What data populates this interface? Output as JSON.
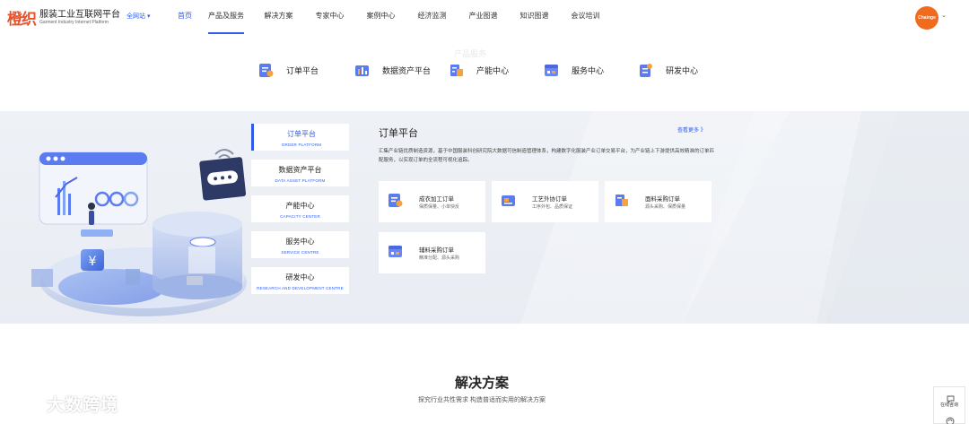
{
  "header": {
    "logo_mark": "橙织",
    "logo_cn": "服装工业互联网平台",
    "logo_en": "Garment Industry Internet Platform",
    "site_switch": "全网站 ▾",
    "nav": [
      "首页",
      "产品及服务",
      "解决方案",
      "专家中心",
      "案例中心",
      "经济监测",
      "产业图谱",
      "知识图谱",
      "会议培训"
    ],
    "active_nav": "产品及服务",
    "avatar_text": "Chainge"
  },
  "categories": [
    {
      "label": "订单平台",
      "icon": "order-icon"
    },
    {
      "label": "数据资产平台",
      "icon": "data-asset-icon"
    },
    {
      "label": "产能中心",
      "icon": "capacity-icon"
    },
    {
      "label": "服务中心",
      "icon": "service-icon"
    },
    {
      "label": "研发中心",
      "icon": "rnd-icon"
    }
  ],
  "ghost_text": "产品服务",
  "tabs": [
    {
      "cn": "订单平台",
      "en": "ORDER PLATFORM"
    },
    {
      "cn": "数据资产平台",
      "en": "DATA ASSET PLATFORM"
    },
    {
      "cn": "产能中心",
      "en": "CAPACITY CENTER"
    },
    {
      "cn": "服务中心",
      "en": "SERVICE CENTRE"
    },
    {
      "cn": "研发中心",
      "en": "RESEARCH AND DEVELOPMENT CENTRE"
    }
  ],
  "content": {
    "title": "订单平台",
    "more": "查看更多 》",
    "description": "汇集产业链优质制造资源，基于中国服装科创研究院大数据可信制造管理体系，构建数字化服装产业订单交易平台，为产业链上下游提供高效精准的订单匹配服务，以实现订单的全流程可视化追踪。",
    "cards": [
      {
        "title": "成衣加工订单",
        "sub": "保质保量、小单快反",
        "icon": "garment-order-icon"
      },
      {
        "title": "工艺外协订单",
        "sub": "工序外包、品质保证",
        "icon": "craft-order-icon"
      },
      {
        "title": "面料采购订单",
        "sub": "源头采购、保质保量",
        "icon": "fabric-order-icon"
      },
      {
        "title": "辅料采购订单",
        "sub": "精准分配、源头采购",
        "icon": "accessory-order-icon"
      }
    ]
  },
  "solutions": {
    "title": "解决方案",
    "subtitle": "探究行业共性需求 构造普适而实用的解决方案"
  },
  "watermark": "大数跨境",
  "float_panel": {
    "label": "在线咨询"
  },
  "colors": {
    "brand": "#2f5bea",
    "logo": "#e8532b",
    "avatar": "#f06b1d",
    "band": "#eef1f6"
  }
}
